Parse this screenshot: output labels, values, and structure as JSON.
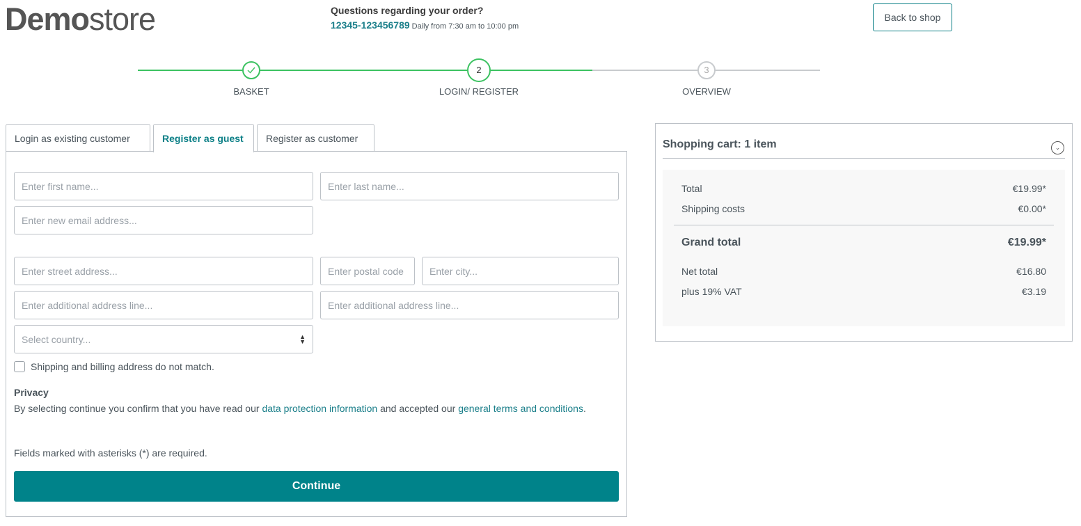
{
  "header": {
    "logo_bold": "Demo",
    "logo_light": "store",
    "question": "Questions regarding your order?",
    "phone": "12345-123456789",
    "hours": "Daily from 7:30 am to 10:00 pm",
    "back_label": "Back to shop"
  },
  "steps": [
    {
      "label": "BASKET",
      "state": "done"
    },
    {
      "label": "LOGIN/ REGISTER",
      "number": "2",
      "state": "current"
    },
    {
      "label": "OVERVIEW",
      "number": "3",
      "state": "upcoming"
    }
  ],
  "colors": {
    "accent": "#00838a",
    "progress": "#3cc261"
  },
  "tabs": [
    {
      "label": "Login as existing customer"
    },
    {
      "label": "Register as guest",
      "active": true
    },
    {
      "label": "Register as customer"
    }
  ],
  "form": {
    "first_name": "Enter first name...",
    "last_name": "Enter last name...",
    "email": "Enter new email address...",
    "street": "Enter street address...",
    "postal": "Enter postal code",
    "city": "Enter city...",
    "addr1": "Enter additional address line...",
    "addr2": "Enter additional address line...",
    "country": "Select country...",
    "mismatch_label": "Shipping and billing address do not match.",
    "privacy_title": "Privacy",
    "privacy_pre": "By selecting continue you confirm that you have read our ",
    "privacy_link1": "data protection information",
    "privacy_mid": " and accepted our ",
    "privacy_link2": "general terms and conditions",
    "privacy_end": ".",
    "required_note": "Fields marked with asterisks (*) are required.",
    "continue_label": "Continue"
  },
  "cart": {
    "title": "Shopping cart: 1 item",
    "rows": [
      {
        "label": "Total",
        "value": "€19.99*"
      },
      {
        "label": "Shipping costs",
        "value": "€0.00*"
      }
    ],
    "grand_label": "Grand total",
    "grand_value": "€19.99*",
    "net_label": "Net total",
    "net_value": "€16.80",
    "vat_label": "plus 19% VAT",
    "vat_value": "€3.19"
  }
}
